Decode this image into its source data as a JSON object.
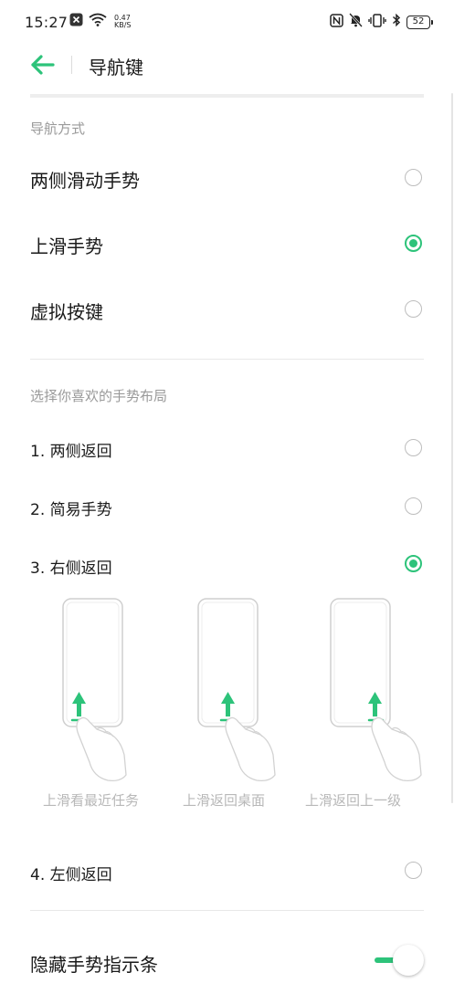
{
  "status_bar": {
    "time": "15:27",
    "speed_value": "0.47",
    "speed_unit": "KB/S",
    "battery": "52"
  },
  "toolbar": {
    "title": "导航键"
  },
  "nav_mode": {
    "header": "导航方式",
    "options": [
      {
        "label": "两侧滑动手势",
        "selected": false
      },
      {
        "label": "上滑手势",
        "selected": true
      },
      {
        "label": "虚拟按键",
        "selected": false
      }
    ]
  },
  "gesture_layout": {
    "header": "选择你喜欢的手势布局",
    "options": [
      {
        "label": "1. 两侧返回",
        "selected": false
      },
      {
        "label": "2. 简易手势",
        "selected": false
      },
      {
        "label": "3. 右侧返回",
        "selected": true
      },
      {
        "label": "4. 左侧返回",
        "selected": false
      }
    ],
    "illustrations": [
      {
        "caption": "上滑看最近任务"
      },
      {
        "caption": "上滑返回桌面"
      },
      {
        "caption": "上滑返回上一级"
      }
    ]
  },
  "hide_indicator": {
    "label": "隐藏手势指示条",
    "enabled": true
  },
  "colors": {
    "accent": "#2dc37a"
  }
}
